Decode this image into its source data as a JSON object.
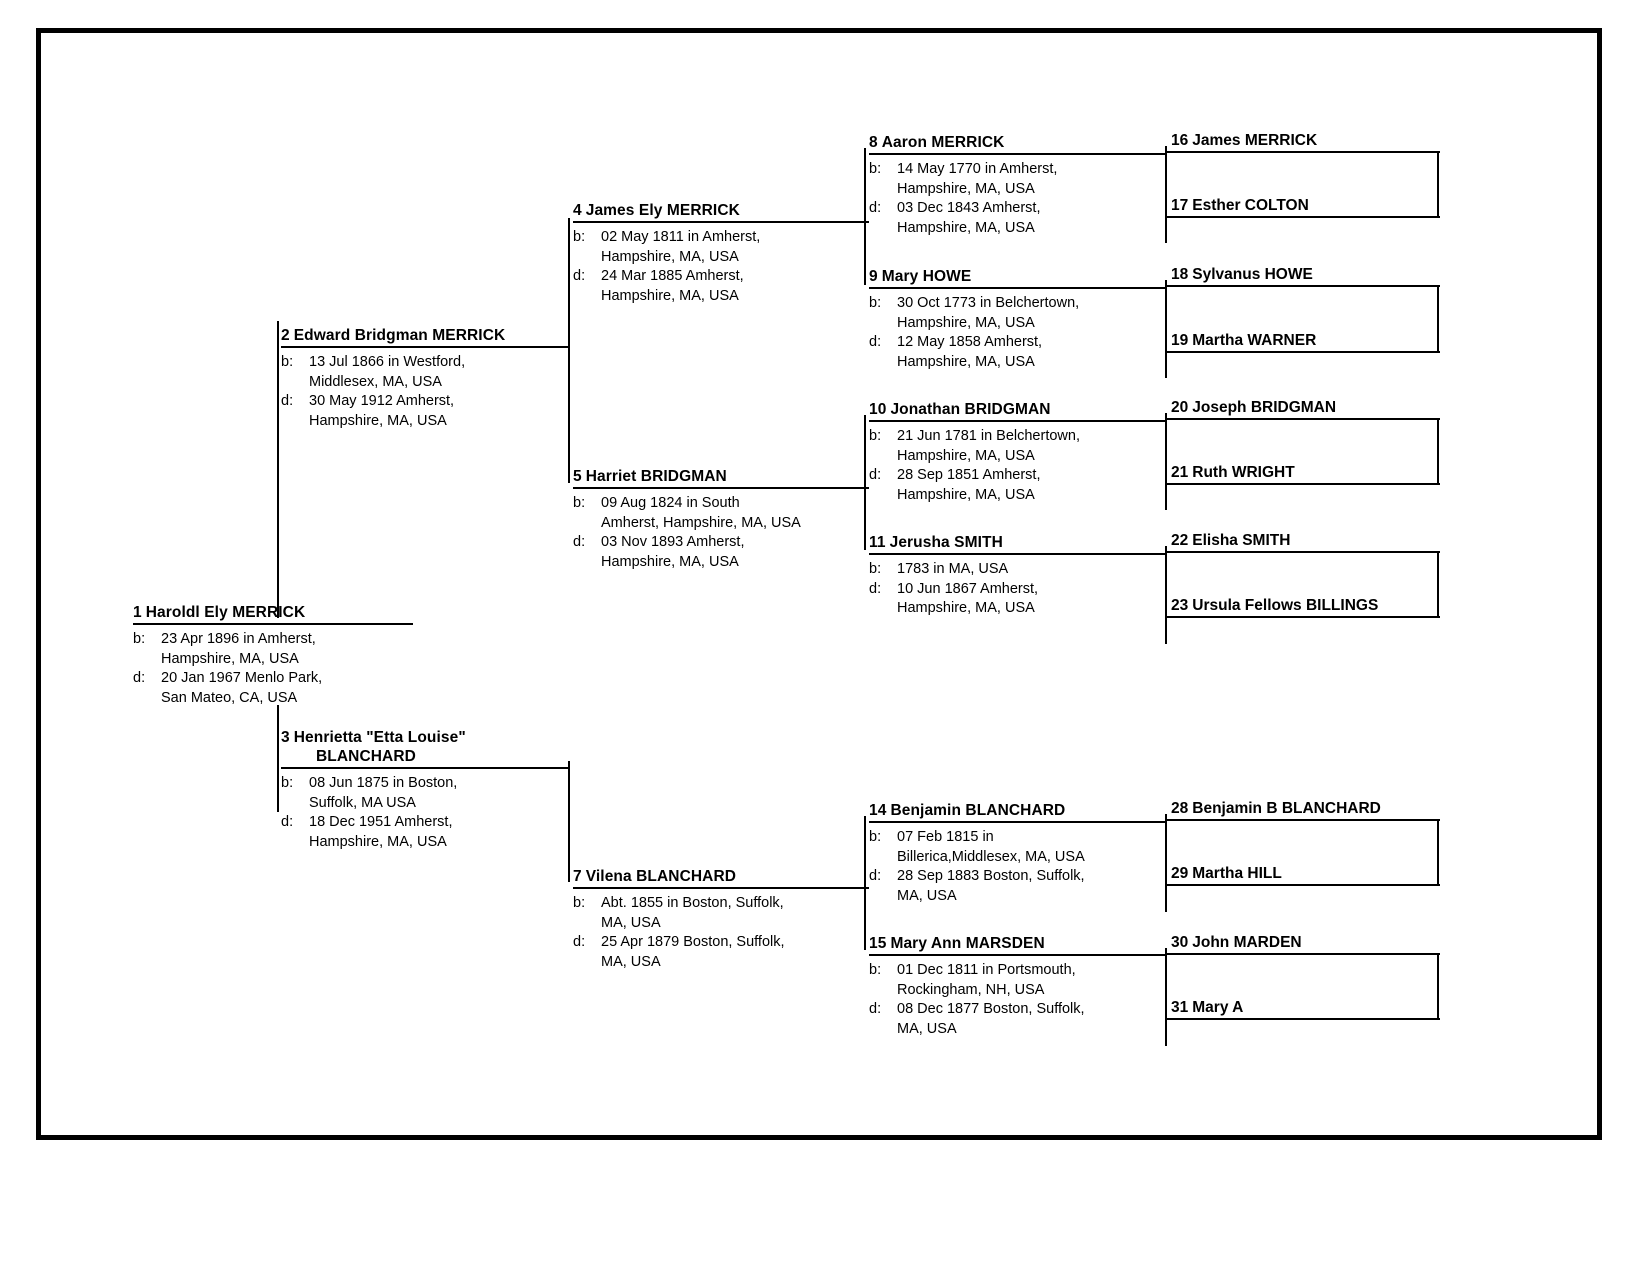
{
  "chart": {
    "type": "pedigree-chart",
    "title": "",
    "generations": 5
  },
  "people": {
    "p1": {
      "number": "1",
      "name": "Haroldl Ely MERRICK",
      "birth_label": "b:",
      "birth": "23 Apr 1896 in Amherst, Hampshire, MA, USA",
      "birth_line1": "23 Apr 1896 in Amherst,",
      "birth_line2": "Hampshire, MA, USA",
      "death_label": "d:",
      "death": "20 Jan 1967 Menlo Park, San Mateo, CA, USA",
      "death_line1": "20 Jan 1967 Menlo Park,",
      "death_line2": "San Mateo, CA, USA"
    },
    "p2": {
      "number": "2",
      "name": "Edward Bridgman MERRICK",
      "birth_label": "b:",
      "birth": "13 Jul 1866 in Westford, Middlesex, MA, USA",
      "birth_line1": "13 Jul 1866 in Westford,",
      "birth_line2": "Middlesex, MA, USA",
      "death_label": "d:",
      "death": "30 May 1912 Amherst, Hampshire, MA, USA",
      "death_line1": "30 May 1912 Amherst,",
      "death_line2": "Hampshire, MA, USA"
    },
    "p3": {
      "number": "3",
      "name": "Henrietta \"Etta Louise\" BLANCHARD",
      "name_line1": "Henrietta \"Etta Louise\"",
      "name_line2": "BLANCHARD",
      "birth_label": "b:",
      "birth": "08 Jun 1875 in Boston, Suffolk, MA USA",
      "birth_line1": "08 Jun 1875 in Boston,",
      "birth_line2": "Suffolk, MA USA",
      "death_label": "d:",
      "death": "18 Dec 1951 Amherst, Hampshire, MA, USA",
      "death_line1": "18 Dec 1951 Amherst,",
      "death_line2": "Hampshire, MA, USA"
    },
    "p4": {
      "number": "4",
      "name": "James Ely MERRICK",
      "birth_label": "b:",
      "birth": "02 May 1811 in Amherst, Hampshire, MA, USA",
      "birth_line1": "02 May 1811 in Amherst,",
      "birth_line2": "Hampshire, MA, USA",
      "death_label": "d:",
      "death": "24 Mar 1885 Amherst, Hampshire, MA, USA",
      "death_line1": "24 Mar 1885 Amherst,",
      "death_line2": "Hampshire, MA, USA"
    },
    "p5": {
      "number": "5",
      "name": "Harriet BRIDGMAN",
      "birth_label": "b:",
      "birth": "09 Aug 1824 in South Amherst, Hampshire, MA, USA",
      "birth_line1": "09 Aug 1824 in South",
      "birth_line2": "Amherst, Hampshire, MA, USA",
      "death_label": "d:",
      "death": "03 Nov 1893 Amherst, Hampshire, MA, USA",
      "death_line1": "03 Nov 1893 Amherst,",
      "death_line2": "Hampshire, MA, USA"
    },
    "p7": {
      "number": "7",
      "name": "Vilena BLANCHARD",
      "birth_label": "b:",
      "birth": "Abt. 1855 in Boston, Suffolk, MA, USA",
      "birth_line1": "Abt. 1855 in Boston, Suffolk,",
      "birth_line2": "MA, USA",
      "death_label": "d:",
      "death": "25 Apr 1879 Boston, Suffolk, MA, USA",
      "death_line1": "25 Apr 1879 Boston, Suffolk,",
      "death_line2": "MA, USA"
    },
    "p8": {
      "number": "8",
      "name": "Aaron MERRICK",
      "birth_label": "b:",
      "birth": "14 May 1770 in Amherst, Hampshire, MA, USA",
      "birth_line1": "14 May 1770 in Amherst,",
      "birth_line2": "Hampshire, MA, USA",
      "death_label": "d:",
      "death": "03 Dec 1843 Amherst, Hampshire, MA, USA",
      "death_line1": "03 Dec 1843 Amherst,",
      "death_line2": "Hampshire, MA, USA"
    },
    "p9": {
      "number": "9",
      "name": "Mary HOWE",
      "birth_label": "b:",
      "birth": "30 Oct 1773 in Belchertown, Hampshire, MA, USA",
      "birth_line1": "30 Oct 1773 in Belchertown,",
      "birth_line2": "Hampshire, MA, USA",
      "death_label": "d:",
      "death": "12 May 1858 Amherst, Hampshire, MA, USA",
      "death_line1": "12 May 1858 Amherst,",
      "death_line2": "Hampshire, MA, USA"
    },
    "p10": {
      "number": "10",
      "name": "Jonathan BRIDGMAN",
      "birth_label": "b:",
      "birth": "21 Jun 1781 in Belchertown, Hampshire, MA, USA",
      "birth_line1": "21 Jun 1781 in Belchertown,",
      "birth_line2": "Hampshire, MA, USA",
      "death_label": "d:",
      "death": "28 Sep 1851 Amherst, Hampshire, MA, USA",
      "death_line1": "28 Sep 1851 Amherst,",
      "death_line2": "Hampshire, MA, USA"
    },
    "p11": {
      "number": "11",
      "name": "Jerusha SMITH",
      "birth_label": "b:",
      "birth": "1783 in MA, USA",
      "birth_line1": "1783 in MA, USA",
      "birth_line2": "",
      "death_label": "d:",
      "death": "10 Jun 1867 Amherst, Hampshire, MA, USA",
      "death_line1": "10 Jun 1867 Amherst,",
      "death_line2": "Hampshire, MA, USA"
    },
    "p14": {
      "number": "14",
      "name": "Benjamin BLANCHARD",
      "birth_label": "b:",
      "birth": "07 Feb 1815 in Billerica,Middlesex, MA, USA",
      "birth_line1": "07 Feb 1815 in",
      "birth_line2": "Billerica,Middlesex, MA, USA",
      "death_label": "d:",
      "death": "28 Sep 1883 Boston, Suffolk, MA, USA",
      "death_line1": "28 Sep 1883 Boston, Suffolk,",
      "death_line2": "MA, USA"
    },
    "p15": {
      "number": "15",
      "name": "Mary Ann MARSDEN",
      "birth_label": "b:",
      "birth": "01 Dec 1811 in Portsmouth, Rockingham, NH, USA",
      "birth_line1": "01 Dec 1811 in Portsmouth,",
      "birth_line2": "Rockingham, NH, USA",
      "death_label": "d:",
      "death": "08 Dec 1877 Boston, Suffolk, MA, USA",
      "death_line1": "08 Dec 1877 Boston, Suffolk,",
      "death_line2": "MA, USA"
    },
    "p16": {
      "number": "16",
      "name": "James MERRICK"
    },
    "p17": {
      "number": "17",
      "name": "Esther COLTON"
    },
    "p18": {
      "number": "18",
      "name": "Sylvanus HOWE"
    },
    "p19": {
      "number": "19",
      "name": "Martha WARNER"
    },
    "p20": {
      "number": "20",
      "name": "Joseph BRIDGMAN"
    },
    "p21": {
      "number": "21",
      "name": "Ruth WRIGHT"
    },
    "p22": {
      "number": "22",
      "name": "Elisha SMITH"
    },
    "p23": {
      "number": "23",
      "name": "Ursula Fellows BILLINGS"
    },
    "p28": {
      "number": "28",
      "name": "Benjamin B BLANCHARD"
    },
    "p29": {
      "number": "29",
      "name": "Martha HILL"
    },
    "p30": {
      "number": "30",
      "name": "John MARDEN"
    },
    "p31": {
      "number": "31",
      "name": "Mary A"
    }
  },
  "colors": {
    "line": "#000000",
    "text": "#000000",
    "background": "#ffffff"
  }
}
